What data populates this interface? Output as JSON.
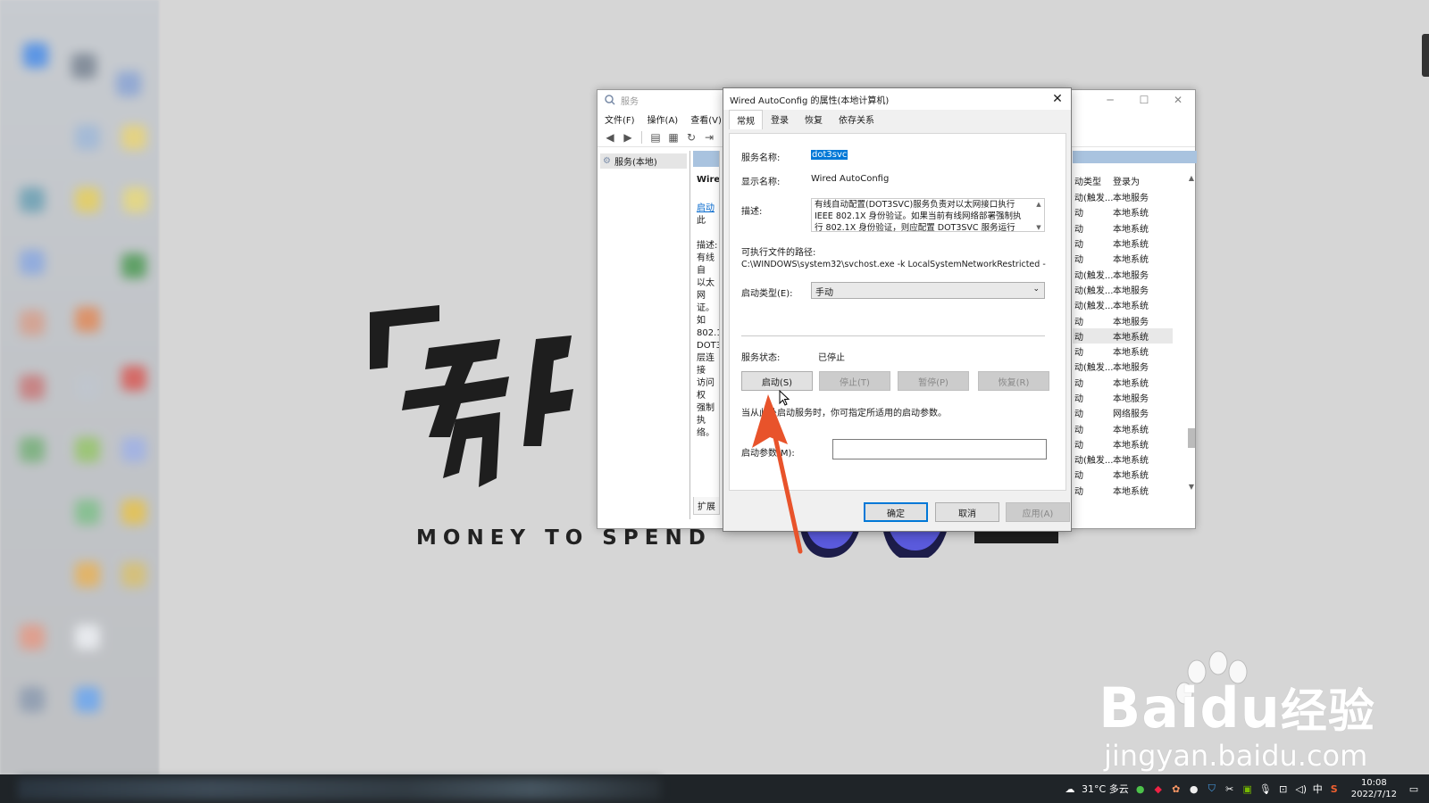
{
  "wallpaper": {
    "logo_glyphs": "「有",
    "slogan": "MONEY TO SPEND"
  },
  "services_window": {
    "title": "服务",
    "menu": [
      "文件(F)",
      "操作(A)",
      "查看(V)"
    ],
    "tree_node": "服务(本地)",
    "detail_name": "Wired",
    "detail_link": "启动",
    "detail_link_suffix": "此",
    "detail_desc_label": "描述:",
    "detail_desc_lines": [
      "有线自",
      "以太网",
      "证。如",
      "802.1X",
      "DOT3",
      "层连接",
      "访问权",
      "强制执",
      "络。"
    ],
    "bottom_tab": "扩展",
    "col_startup": "动类型",
    "col_logon": "登录为",
    "rows": [
      {
        "startup": "动(触发...",
        "logon": "本地服务"
      },
      {
        "startup": "动",
        "logon": "本地系统"
      },
      {
        "startup": "动",
        "logon": "本地系统"
      },
      {
        "startup": "动",
        "logon": "本地系统"
      },
      {
        "startup": "动",
        "logon": "本地系统"
      },
      {
        "startup": "动(触发...",
        "logon": "本地服务"
      },
      {
        "startup": "动(触发...",
        "logon": "本地服务"
      },
      {
        "startup": "动(触发...",
        "logon": "本地系统"
      },
      {
        "startup": "动",
        "logon": "本地服务"
      },
      {
        "startup": "动",
        "logon": "本地系统",
        "selected": true
      },
      {
        "startup": "动",
        "logon": "本地系统"
      },
      {
        "startup": "动(触发...",
        "logon": "本地服务"
      },
      {
        "startup": "动",
        "logon": "本地系统"
      },
      {
        "startup": "动",
        "logon": "本地服务"
      },
      {
        "startup": "动",
        "logon": "网络服务"
      },
      {
        "startup": "动",
        "logon": "本地系统"
      },
      {
        "startup": "动",
        "logon": "本地系统"
      },
      {
        "startup": "动(触发...",
        "logon": "本地系统"
      },
      {
        "startup": "动",
        "logon": "本地系统"
      },
      {
        "startup": "动",
        "logon": "本地系统"
      }
    ]
  },
  "dialog": {
    "title": "Wired AutoConfig 的属性(本地计算机)",
    "tabs": [
      "常规",
      "登录",
      "恢复",
      "依存关系"
    ],
    "service_name_label": "服务名称:",
    "service_name": "dot3svc",
    "display_name_label": "显示名称:",
    "display_name": "Wired AutoConfig",
    "description_label": "描述:",
    "description_lines": [
      "有线自动配置(DOT3SVC)服务负责对以太网接口执行",
      "IEEE 802.1X 身份验证。如果当前有线网络部署强制执",
      "行 802.1X 身份验证，则应配置 DOT3SVC 服务运行"
    ],
    "path_label": "可执行文件的路径:",
    "path": "C:\\WINDOWS\\system32\\svchost.exe -k LocalSystemNetworkRestricted -",
    "startup_type_label": "启动类型(E):",
    "startup_type": "手动",
    "status_label": "服务状态:",
    "status": "已停止",
    "btn_start": "启动(S)",
    "btn_stop": "停止(T)",
    "btn_pause": "暂停(P)",
    "btn_resume": "恢复(R)",
    "hint": "当从此处启动服务时，你可指定所适用的启动参数。",
    "param_label": "启动参数(M):",
    "param_value": "",
    "btn_ok": "确定",
    "btn_cancel": "取消",
    "btn_apply": "应用(A)"
  },
  "watermark": {
    "brand": "Bai",
    "brand2": "du",
    "brand_cn": "经验",
    "url": "jingyan.baidu.com"
  },
  "taskbar": {
    "weather": "31°C 多云",
    "ime": "中",
    "time": "10:08",
    "date": "2022/7/12"
  },
  "colors": {
    "accent": "#0078d7",
    "arrow": "#e8532b",
    "taskbar": "#1f2428"
  }
}
